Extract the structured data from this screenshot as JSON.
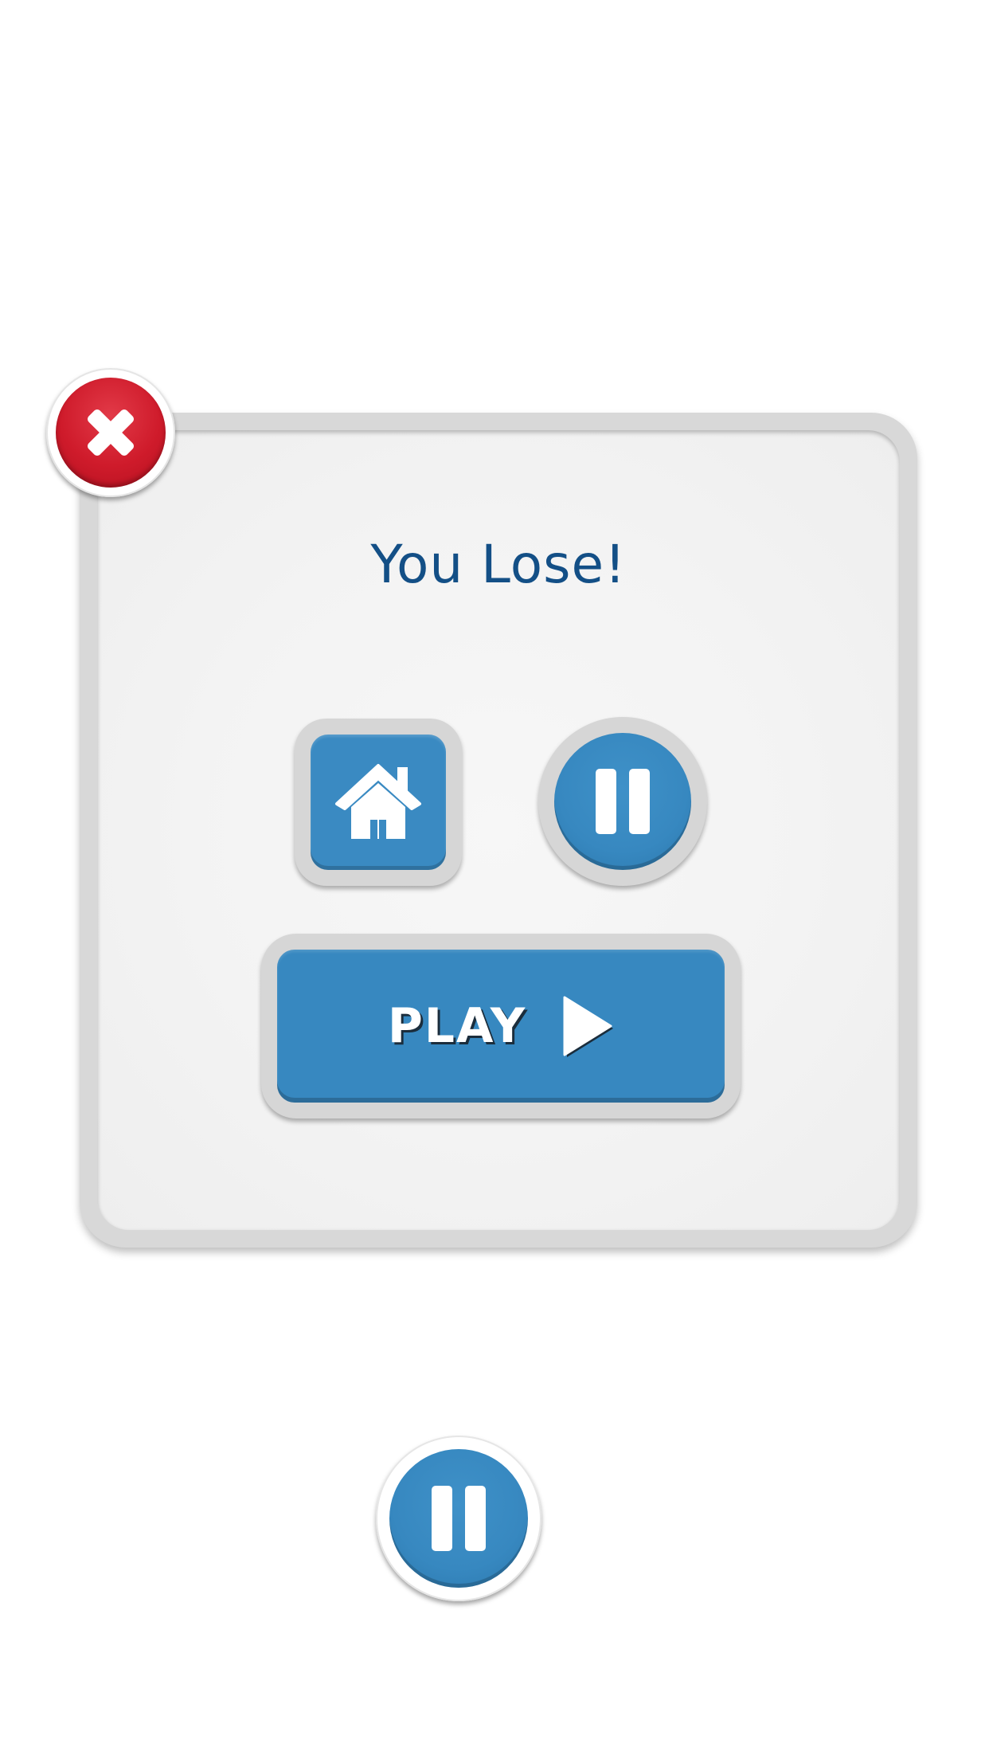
{
  "dialog": {
    "title": "You Lose!",
    "play_label": "PLAY",
    "buttons": {
      "close": "close-icon",
      "home": "home-icon",
      "pause": "pause-icon",
      "play": "play-icon"
    }
  },
  "hud": {
    "pause_button": "pause-icon"
  },
  "colors": {
    "accent_blue": "#3788c0",
    "title_blue": "#134f86",
    "close_red": "#cf1b2b",
    "frame_gray": "#d8d8d8",
    "panel_bg": "#f3f3f3"
  }
}
